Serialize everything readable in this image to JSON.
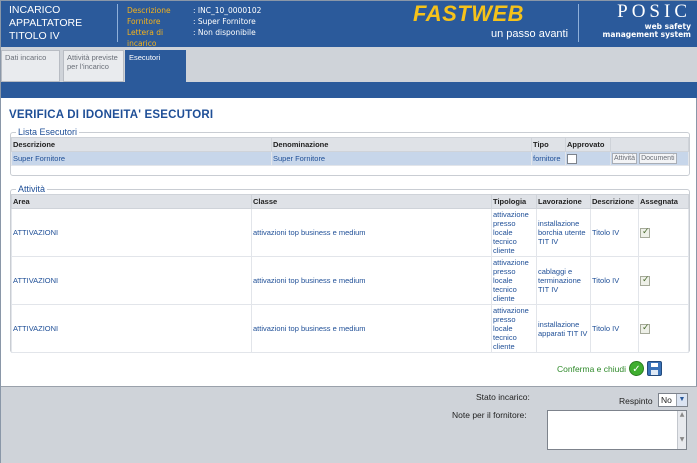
{
  "header": {
    "title_lines": [
      "INCARICO",
      "APPALTATORE",
      "TITOLO IV"
    ],
    "info": [
      {
        "label": "Descrizione",
        "value": ": INC_10_0000102"
      },
      {
        "label": "Fornitore",
        "value": ": Super Fornitore"
      },
      {
        "label": "Lettera di incarico",
        "value": ": Non disponibile"
      }
    ],
    "brand_name": "FASTWEB",
    "brand_tagline": "un passo avanti",
    "product_name": "POSIC",
    "product_subtitle": [
      "web safety",
      "management system"
    ]
  },
  "tabs": [
    {
      "label": "Dati incarico",
      "active": false
    },
    {
      "label": "Attività previste per l'incarico",
      "active": false
    },
    {
      "label": "Esecutori",
      "active": true
    }
  ],
  "page_title": "VERIFICA DI IDONEITA' ESECUTORI",
  "esecutori": {
    "legend": "Lista Esecutori",
    "columns": [
      "Descrizione",
      "Denominazione",
      "Tipo",
      "Approvato",
      ""
    ],
    "rows": [
      {
        "descrizione": "Super Fornitore",
        "denominazione": "Super Fornitore",
        "tipo": "fornitore",
        "approvato": false,
        "btn_attivita": "Attività",
        "btn_documenti": "Documenti"
      }
    ]
  },
  "attivita": {
    "legend": "Attività",
    "columns": [
      "Area",
      "Classe",
      "Tipologia",
      "Lavorazione",
      "Descrizione",
      "Assegnata"
    ],
    "rows": [
      {
        "area": "ATTIVAZIONI",
        "classe": "attivazioni top business e medium",
        "tipologia": "attivazione presso locale tecnico cliente",
        "lavorazione": "installazione borchia utente TIT IV",
        "descrizione": "Titolo IV",
        "assegnata": true
      },
      {
        "area": "ATTIVAZIONI",
        "classe": "attivazioni top business e medium",
        "tipologia": "attivazione presso locale tecnico cliente",
        "lavorazione": "cablaggi e terminazione TIT IV",
        "descrizione": "Titolo IV",
        "assegnata": true
      },
      {
        "area": "ATTIVAZIONI",
        "classe": "attivazioni top business e medium",
        "tipologia": "attivazione presso locale tecnico cliente",
        "lavorazione": "installazione apparati TIT IV",
        "descrizione": "Titolo IV",
        "assegnata": true
      }
    ]
  },
  "actions": {
    "confirm_label": "Conferma e chiudi"
  },
  "footer": {
    "stato_label": "Stato incarico:",
    "stato_value": "Respinto",
    "select_value": "No",
    "note_label": "Note per il fornitore:",
    "note_value": ""
  }
}
